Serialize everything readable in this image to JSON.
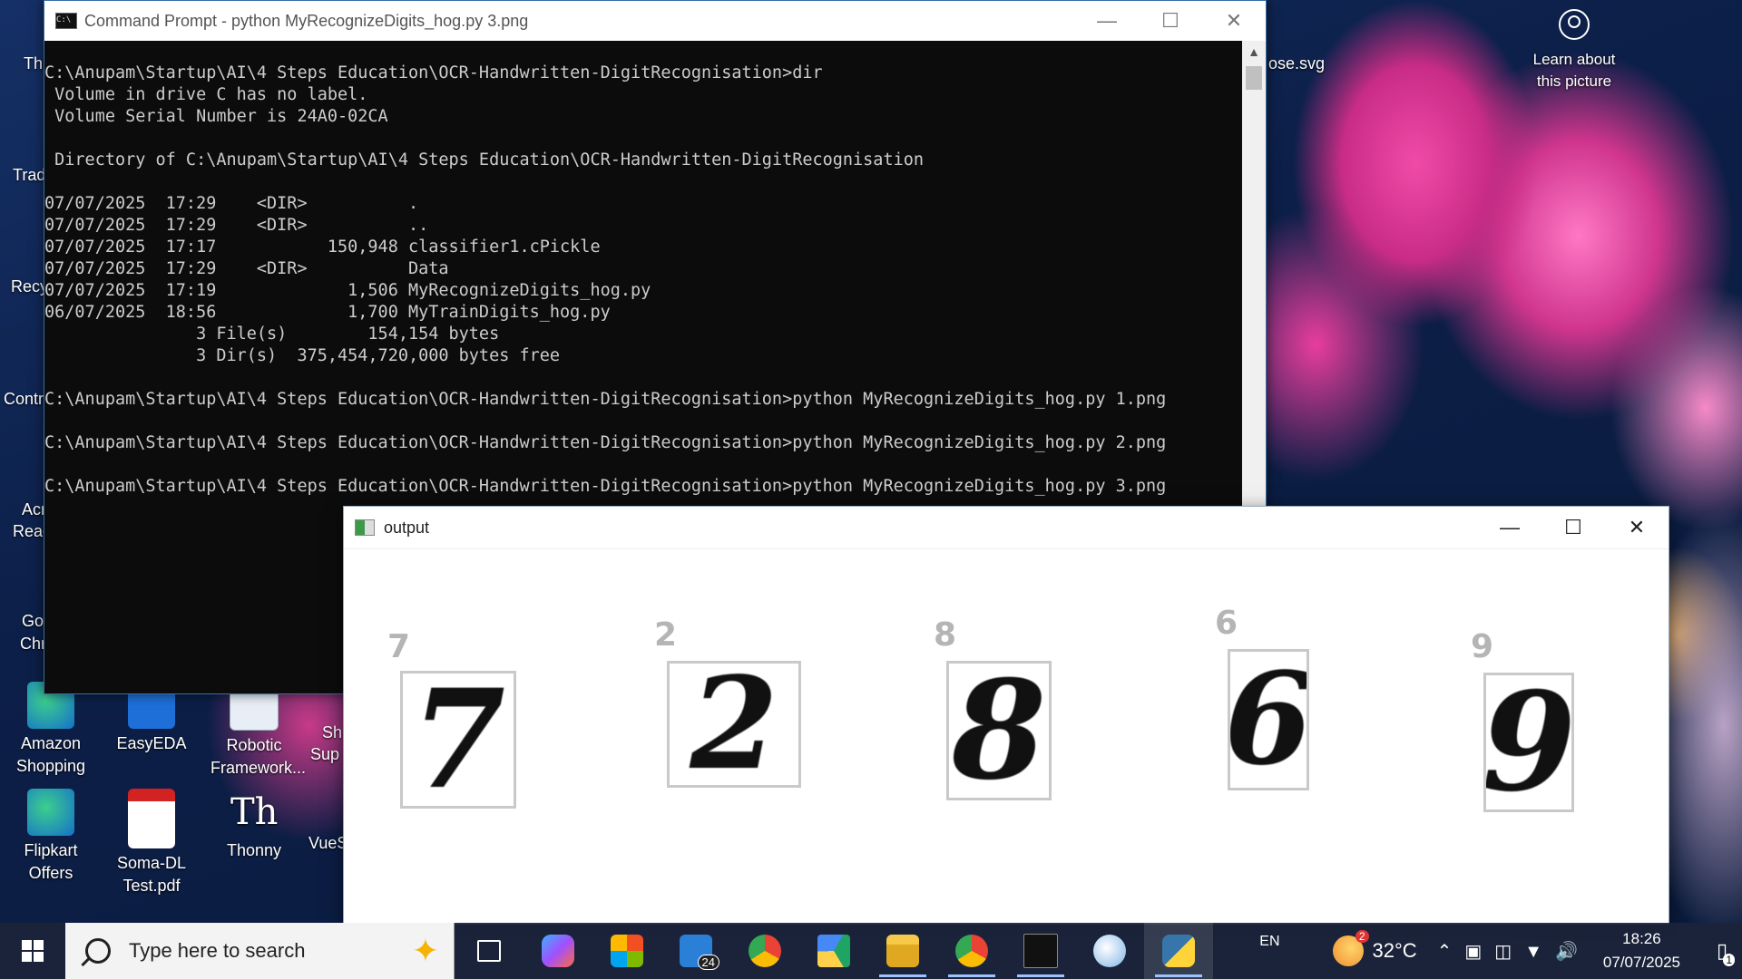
{
  "desktop": {
    "learn_label": "Learn about this picture",
    "icons": [
      {
        "label": "Amazon Shopping"
      },
      {
        "label": "EasyEDA"
      },
      {
        "label": "Robotic Framework..."
      },
      {
        "label": "Flipkart Offers"
      },
      {
        "label": "Soma-DL Test.pdf"
      },
      {
        "label": "Thonny"
      }
    ],
    "clipped": [
      "Thi",
      "Trad",
      "Recy",
      "Contr",
      "Acr",
      "Reac",
      "Go",
      "Chr",
      "Sh",
      "Sup",
      "VueS",
      "ose.svg"
    ]
  },
  "cmd": {
    "title": "Command Prompt - python  MyRecognizeDigits_hog.py 3.png",
    "lines": [
      "",
      "C:\\Anupam\\Startup\\AI\\4 Steps Education\\OCR-Handwritten-DigitRecognisation>dir",
      " Volume in drive C has no label.",
      " Volume Serial Number is 24A0-02CA",
      "",
      " Directory of C:\\Anupam\\Startup\\AI\\4 Steps Education\\OCR-Handwritten-DigitRecognisation",
      "",
      "07/07/2025  17:29    <DIR>          .",
      "07/07/2025  17:29    <DIR>          ..",
      "07/07/2025  17:17           150,948 classifier1.cPickle",
      "07/07/2025  17:29    <DIR>          Data",
      "07/07/2025  17:19             1,506 MyRecognizeDigits_hog.py",
      "06/07/2025  18:56             1,700 MyTrainDigits_hog.py",
      "               3 File(s)        154,154 bytes",
      "               3 Dir(s)  375,454,720,000 bytes free",
      "",
      "C:\\Anupam\\Startup\\AI\\4 Steps Education\\OCR-Handwritten-DigitRecognisation>python MyRecognizeDigits_hog.py 1.png",
      "",
      "C:\\Anupam\\Startup\\AI\\4 Steps Education\\OCR-Handwritten-DigitRecognisation>python MyRecognizeDigits_hog.py 2.png",
      "",
      "C:\\Anupam\\Startup\\AI\\4 Steps Education\\OCR-Handwritten-DigitRecognisation>python MyRecognizeDigits_hog.py 3.png"
    ]
  },
  "output": {
    "title": "output",
    "digits": [
      {
        "handwritten": "7",
        "predicted": "7"
      },
      {
        "handwritten": "2",
        "predicted": "2"
      },
      {
        "handwritten": "8",
        "predicted": "8"
      },
      {
        "handwritten": "6",
        "predicted": "6"
      },
      {
        "handwritten": "9",
        "predicted": "9"
      }
    ]
  },
  "taskbar": {
    "search_placeholder": "Type here to search",
    "mail_badge": "24",
    "lang": "EN",
    "weather_badge": "2",
    "temperature": "32°C",
    "time": "18:26",
    "date": "07/07/2025",
    "notifications": "1",
    "apps": [
      "task-view-icon",
      "copilot-icon",
      "store-icon",
      "mail-icon",
      "chrome-icon",
      "drive-icon",
      "file-explorer-icon",
      "chrome-profile-icon",
      "terminal-icon",
      "paint-icon",
      "python-icon"
    ]
  }
}
